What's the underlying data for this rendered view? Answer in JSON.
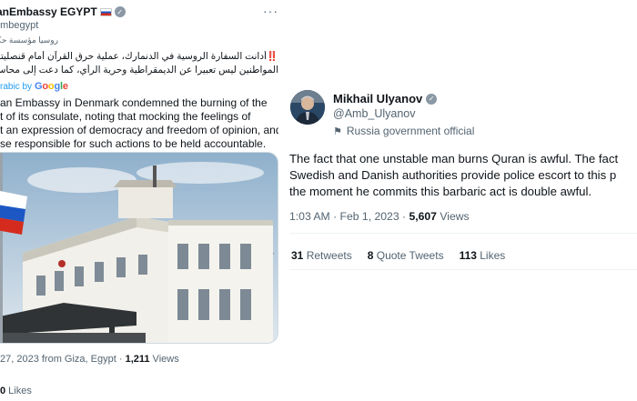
{
  "left_tweet": {
    "display_name": "anEmbassy EGYPT",
    "handle": "embegypt",
    "account_label": "روسيا مؤسسة حكو",
    "more_icon": "more-dots-icon",
    "arabic_line_1": "أدانت السفارة الروسية في الدنمارك، عملية حرق القرآن أمام قنصليتها، مشيرة إلى أن",
    "arabic_line_2": "المواطنين ليس تعبيرا عن الديمقراطية وحرية الرأي، كما دعت إلى محاسبة المسؤولين عن",
    "bang": "‼️",
    "translated_by": "rabic by",
    "google": [
      "G",
      "o",
      "o",
      "g",
      "l",
      "e"
    ],
    "body_lines": [
      "an Embassy in Denmark condemned the burning of the",
      "t of its consulate, noting that mocking the feelings of",
      "t an expression of democracy and freedom of opinion, and",
      "se responsible for such actions to be held accountable."
    ],
    "meta_prefix": "27, 2023 from Giza, Egypt · ",
    "views_count": "1,211",
    "views_label": " Views",
    "bottom_count": "0",
    "bottom_label": " Likes"
  },
  "right_tweet": {
    "display_name": "Mikhail Ulyanov",
    "handle": "@Amb_Ulyanov",
    "account_label": "Russia government official",
    "body_lines": [
      "The fact that one unstable man burns Quran is awful. The fact",
      "Swedish and Danish authorities provide police escort to this p",
      "the moment he commits this barbaric act is double awful."
    ],
    "time": "1:03 AM · Feb 1, 2023 · ",
    "views_count": "5,607",
    "views_label": " Views",
    "stats": [
      {
        "count": "31",
        "label": " Retweets"
      },
      {
        "count": "8",
        "label": " Quote Tweets"
      },
      {
        "count": "113",
        "label": " Likes"
      }
    ]
  },
  "colors": {
    "text_primary": "#0f1419",
    "text_secondary": "#536471",
    "link": "#1d9bf0",
    "verified_gray": "#8b98a5"
  }
}
